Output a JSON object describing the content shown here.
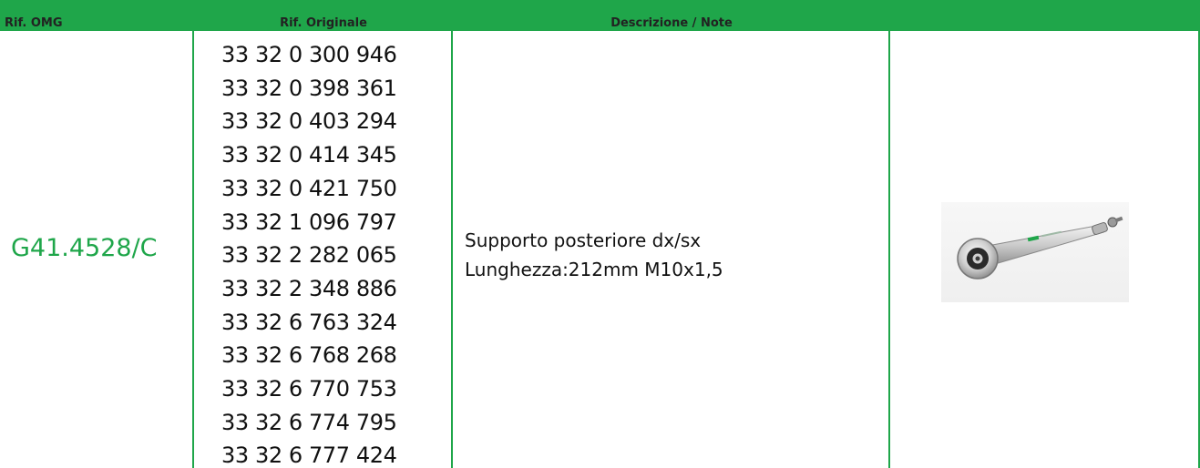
{
  "table": {
    "headers": {
      "omg": "Rif. OMG",
      "original": "Rif. Originale",
      "description": "Descrizione / Note"
    },
    "row": {
      "omg_code": "G41.4528/C",
      "original_refs": [
        "33 32 0 300 946",
        "33 32 0 398 361",
        "33 32 0 403 294",
        "33 32 0 414 345",
        "33 32 0 421 750",
        "33 32 1 096 797",
        "33 32 2 282 065",
        "33 32 2 348 886",
        "33 32 6 763 324",
        "33 32 6 768 268",
        "33 32 6 770 753",
        "33 32 6 774 795",
        "33 32 6 777 424"
      ],
      "description_lines": [
        "Supporto posteriore dx/sx",
        "Lunghezza:212mm M10x1,5"
      ],
      "image_alt": "control-arm-part-image"
    }
  },
  "colors": {
    "brand_green": "#1fa64a",
    "text": "#111111"
  }
}
